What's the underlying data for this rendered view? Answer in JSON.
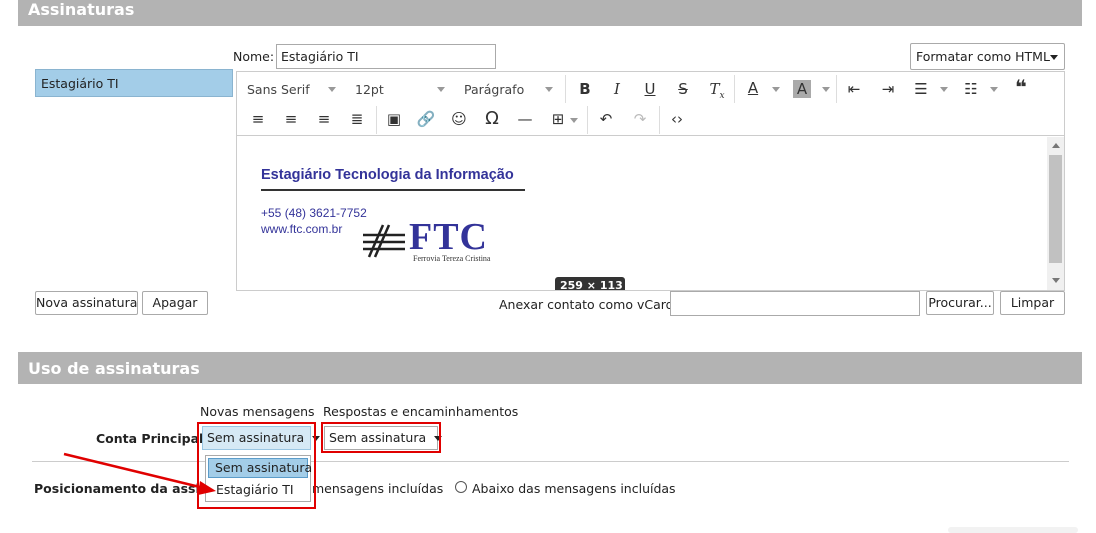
{
  "signatures": {
    "section_title": "Assinaturas",
    "list": [
      "Estagiário TI"
    ],
    "name_label": "Nome:",
    "name_value": "Estagiário TI",
    "format_button": "Formatar como HTML",
    "new_button": "Nova assinatura",
    "delete_button": "Apagar",
    "vcard_label": "Anexar contato como vCard:",
    "vcard_value": "",
    "browse_button": "Procurar...",
    "clear_button": "Limpar"
  },
  "editor": {
    "font_family": "Sans Serif",
    "font_size": "12pt",
    "block_format": "Parágrafo",
    "content": {
      "title": "Estagiário Tecnologia da Informação",
      "phone": "+55 (48) 3621-7752",
      "website": "www.ftc.com.br",
      "logo_text": "FTC",
      "logo_subtext": "Ferrovia Tereza Cristina",
      "image_size_tooltip": "259 × 113"
    }
  },
  "usage": {
    "section_title": "Uso de assinaturas",
    "col_new": "Novas mensagens",
    "col_replies": "Respostas e encaminhamentos",
    "account_label": "Conta Principal:",
    "new_select_value": "Sem assinatura",
    "reply_select_value": "Sem assinatura",
    "dropdown_options": [
      "Sem assinatura",
      "Estagiário TI"
    ],
    "position_label": "Posicionamento da assinatura",
    "position_option_above": "mensagens incluídas",
    "position_option_below": "Abaixo das mensagens incluídas"
  },
  "colors": {
    "header_bg": "#b3b3b3",
    "selected_bg": "#a3cde8",
    "highlight_red": "#e00000",
    "signature_title": "#333399"
  }
}
